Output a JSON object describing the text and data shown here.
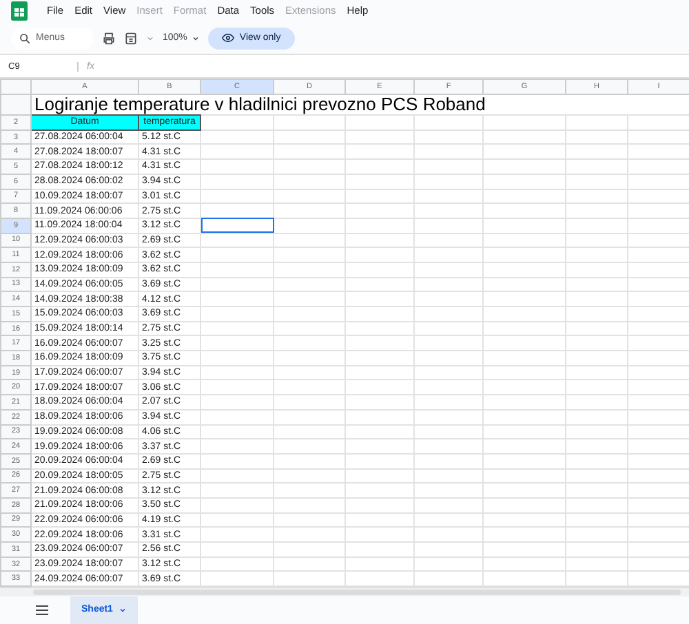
{
  "menu": [
    {
      "label": "File",
      "disabled": false
    },
    {
      "label": "Edit",
      "disabled": false
    },
    {
      "label": "View",
      "disabled": false
    },
    {
      "label": "Insert",
      "disabled": true
    },
    {
      "label": "Format",
      "disabled": true
    },
    {
      "label": "Data",
      "disabled": false
    },
    {
      "label": "Tools",
      "disabled": false
    },
    {
      "label": "Extensions",
      "disabled": true
    },
    {
      "label": "Help",
      "disabled": false
    }
  ],
  "toolbar": {
    "search_placeholder": "Menus",
    "zoom": "100%",
    "mode": "View only"
  },
  "formula_bar": {
    "cell_ref": "C9",
    "fx": "fx"
  },
  "columns": [
    {
      "label": "A",
      "selected": false
    },
    {
      "label": "B",
      "selected": false
    },
    {
      "label": "C",
      "selected": true
    },
    {
      "label": "D",
      "selected": false
    },
    {
      "label": "E",
      "selected": false
    },
    {
      "label": "F",
      "selected": false
    },
    {
      "label": "G",
      "selected": false
    },
    {
      "label": "H",
      "selected": false
    },
    {
      "label": "I",
      "selected": false
    }
  ],
  "title": "Logiranje temperature v hladilnici prevozno PCS Roband",
  "header_row": {
    "number": "2",
    "cells": [
      "Datum",
      "temperatura"
    ]
  },
  "rows": [
    {
      "number": "3",
      "date": "27.08.2024 06:00:04",
      "temp": "5.12 st.C",
      "selected": false
    },
    {
      "number": "4",
      "date": "27.08.2024 18:00:07",
      "temp": "4.31 st.C",
      "selected": false
    },
    {
      "number": "5",
      "date": "27.08.2024 18:00:12",
      "temp": "4.31 st.C",
      "selected": false
    },
    {
      "number": "6",
      "date": "28.08.2024 06:00:02",
      "temp": "3.94 st.C",
      "selected": false
    },
    {
      "number": "7",
      "date": "10.09.2024 18:00:07",
      "temp": "3.01 st.C",
      "selected": false
    },
    {
      "number": "8",
      "date": "11.09.2024 06:00:06",
      "temp": "2.75 st.C",
      "selected": false
    },
    {
      "number": "9",
      "date": "11.09.2024 18:00:04",
      "temp": "3.12 st.C",
      "selected": true
    },
    {
      "number": "10",
      "date": "12.09.2024 06:00:03",
      "temp": "2.69 st.C",
      "selected": false
    },
    {
      "number": "11",
      "date": "12.09.2024 18:00:06",
      "temp": "3.62 st.C",
      "selected": false
    },
    {
      "number": "12",
      "date": "13.09.2024 18:00:09",
      "temp": "3.62 st.C",
      "selected": false
    },
    {
      "number": "13",
      "date": "14.09.2024 06:00:05",
      "temp": "3.69 st.C",
      "selected": false
    },
    {
      "number": "14",
      "date": "14.09.2024 18:00:38",
      "temp": "4.12 st.C",
      "selected": false
    },
    {
      "number": "15",
      "date": "15.09.2024 06:00:03",
      "temp": "3.69 st.C",
      "selected": false
    },
    {
      "number": "16",
      "date": "15.09.2024 18:00:14",
      "temp": "2.75 st.C",
      "selected": false
    },
    {
      "number": "17",
      "date": "16.09.2024 06:00:07",
      "temp": "3.25 st.C",
      "selected": false
    },
    {
      "number": "18",
      "date": "16.09.2024 18:00:09",
      "temp": "3.75 st.C",
      "selected": false
    },
    {
      "number": "19",
      "date": "17.09.2024 06:00:07",
      "temp": "3.94 st.C",
      "selected": false
    },
    {
      "number": "20",
      "date": "17.09.2024 18:00:07",
      "temp": "3.06 st.C",
      "selected": false
    },
    {
      "number": "21",
      "date": "18.09.2024 06:00:04",
      "temp": "2.07 st.C",
      "selected": false
    },
    {
      "number": "22",
      "date": "18.09.2024 18:00:06",
      "temp": "3.94 st.C",
      "selected": false
    },
    {
      "number": "23",
      "date": "19.09.2024 06:00:08",
      "temp": "4.06 st.C",
      "selected": false
    },
    {
      "number": "24",
      "date": "19.09.2024 18:00:06",
      "temp": "3.37 st.C",
      "selected": false
    },
    {
      "number": "25",
      "date": "20.09.2024 06:00:04",
      "temp": "2.69 st.C",
      "selected": false
    },
    {
      "number": "26",
      "date": "20.09.2024 18:00:05",
      "temp": "2.75 st.C",
      "selected": false
    },
    {
      "number": "27",
      "date": "21.09.2024 06:00:08",
      "temp": "3.12 st.C",
      "selected": false
    },
    {
      "number": "28",
      "date": "21.09.2024 18:00:06",
      "temp": "3.50 st.C",
      "selected": false
    },
    {
      "number": "29",
      "date": "22.09.2024 06:00:06",
      "temp": "4.19 st.C",
      "selected": false
    },
    {
      "number": "30",
      "date": "22.09.2024 18:00:06",
      "temp": "3.31 st.C",
      "selected": false
    },
    {
      "number": "31",
      "date": "23.09.2024 06:00:07",
      "temp": "2.56 st.C",
      "selected": false
    },
    {
      "number": "32",
      "date": "23.09.2024 18:00:07",
      "temp": "3.12 st.C",
      "selected": false
    },
    {
      "number": "33",
      "date": "24.09.2024 06:00:07",
      "temp": "3.69 st.C",
      "selected": false
    }
  ],
  "sheets": [
    {
      "label": "Sheet1",
      "selected": true
    }
  ]
}
